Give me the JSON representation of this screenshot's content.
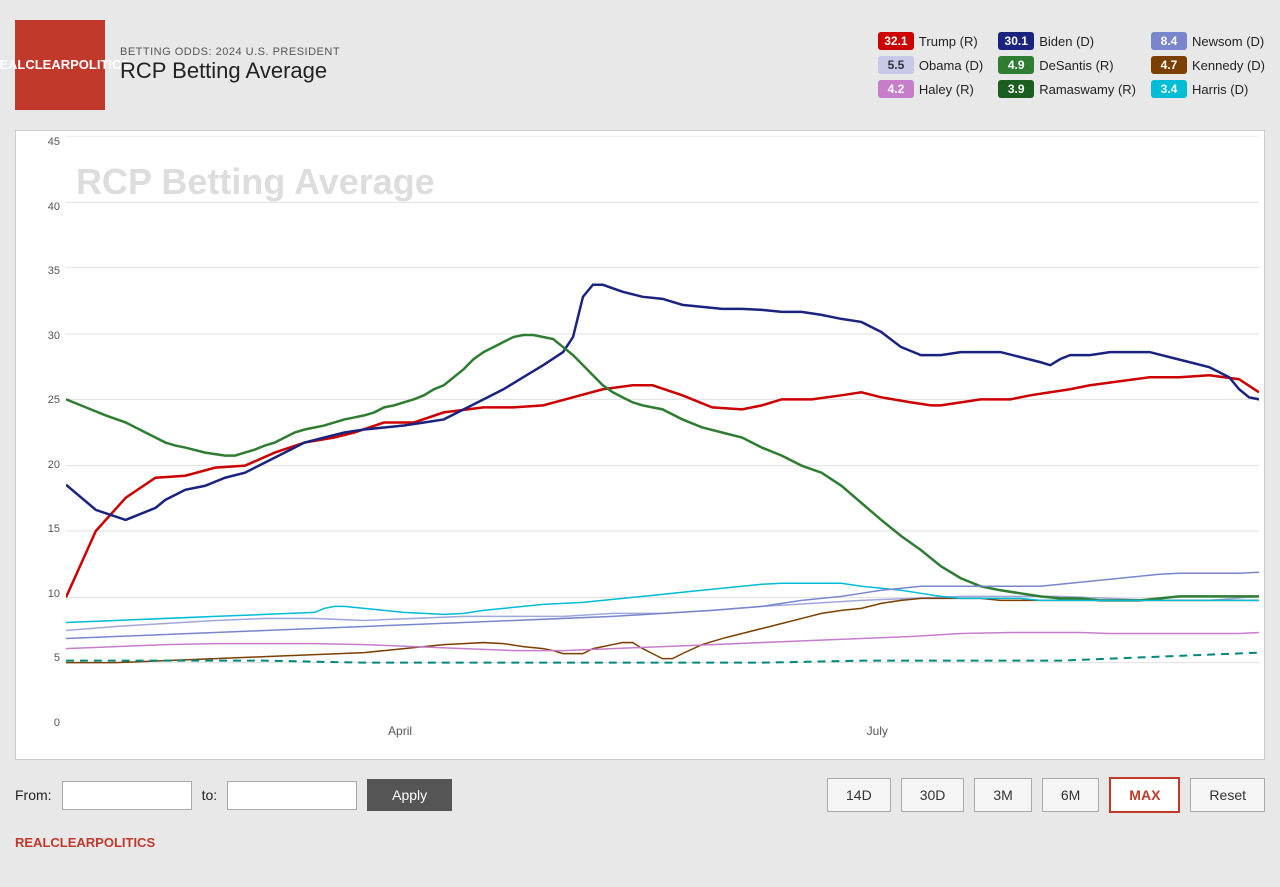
{
  "header": {
    "logo_line1": "REAL",
    "logo_line2": "CLEAR",
    "logo_line3": "POLITICS",
    "subtitle": "BETTING ODDS: 2024 U.S. PRESIDENT",
    "title": "RCP Betting Average"
  },
  "legend": {
    "items": [
      {
        "value": "32.1",
        "name": "Trump (R)",
        "color": "#cc0000",
        "text_color": "white"
      },
      {
        "value": "30.1",
        "name": "Biden (D)",
        "color": "#1a237e",
        "text_color": "white"
      },
      {
        "value": "8.4",
        "name": "Newsom (D)",
        "color": "#7986cb",
        "text_color": "white"
      },
      {
        "value": "5.5",
        "name": "Obama (D)",
        "color": "#c8c8e8",
        "text_color": "#333"
      },
      {
        "value": "4.9",
        "name": "DeSantis (R)",
        "color": "#2e7d32",
        "text_color": "white"
      },
      {
        "value": "4.7",
        "name": "Kennedy (D)",
        "color": "#7b3f00",
        "text_color": "white"
      },
      {
        "value": "4.2",
        "name": "Haley (R)",
        "color": "#c77dca",
        "text_color": "white"
      },
      {
        "value": "3.9",
        "name": "Ramaswamy (R)",
        "color": "#1b5e20",
        "text_color": "white"
      },
      {
        "value": "3.4",
        "name": "Harris (D)",
        "color": "#00bcd4",
        "text_color": "white"
      }
    ]
  },
  "chart": {
    "watermark": "RCP Betting Average",
    "y_labels": [
      "0",
      "5",
      "10",
      "15",
      "20",
      "25",
      "30",
      "35",
      "40",
      "45"
    ],
    "x_labels": [
      {
        "label": "April",
        "pct": 28
      },
      {
        "label": "July",
        "pct": 68
      }
    ]
  },
  "footer": {
    "from_label": "From:",
    "to_label": "to:",
    "from_value": "",
    "to_value": "",
    "from_placeholder": "",
    "to_placeholder": "",
    "apply_label": "Apply",
    "buttons": [
      "14D",
      "30D",
      "3M",
      "6M",
      "MAX",
      "Reset"
    ],
    "active_button": "MAX"
  },
  "brand": "REALCLEARPOLITICS"
}
